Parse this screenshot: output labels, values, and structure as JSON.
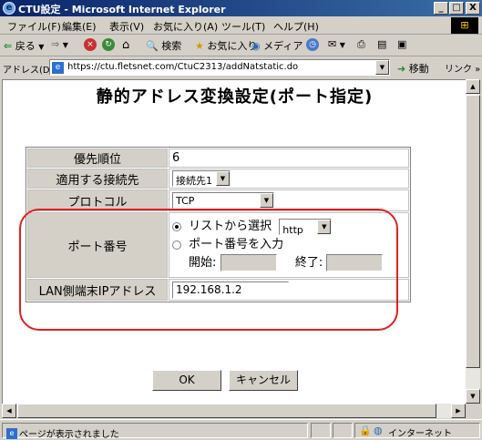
{
  "window": {
    "title": "CTU設定 - Microsoft Internet Explorer",
    "minimize": "_",
    "maximize": "□",
    "close": "X"
  },
  "menubar": {
    "items": [
      "ファイル(F)",
      "編集(E)",
      "表示(V)",
      "お気に入り(A)",
      "ツール(T)",
      "ヘルプ(H)"
    ]
  },
  "toolbar": {
    "back": "戻る",
    "search": "検索",
    "favorites": "お気に入り",
    "media": "メディア"
  },
  "address": {
    "label": "アドレス(D)",
    "url": "https://ctu.fletsnet.com/CtuC2313/addNatstatic.do",
    "go": "移動",
    "links": "リンク »"
  },
  "page": {
    "title": "静的アドレス変換設定(ポート指定)",
    "rows": {
      "priority": {
        "label": "優先順位",
        "value": "6"
      },
      "connection": {
        "label": "適用する接続先",
        "value": "接続先1"
      },
      "protocol": {
        "label": "プロトコル",
        "value": "TCP"
      },
      "port": {
        "label": "ポート番号",
        "list_option": "リストから選択",
        "list_value": "http",
        "manual_option": "ポート番号を入力",
        "start_label": "開始:",
        "end_label": "終了:",
        "start_value": "",
        "end_value": ""
      },
      "lan_ip": {
        "label": "LAN側端末IPアドレス",
        "value": "192.168.1.2"
      }
    },
    "ok_button": "OK",
    "cancel_button": "キャンセル"
  },
  "statusbar": {
    "text": "ページが表示されました",
    "zone": "インターネット"
  }
}
